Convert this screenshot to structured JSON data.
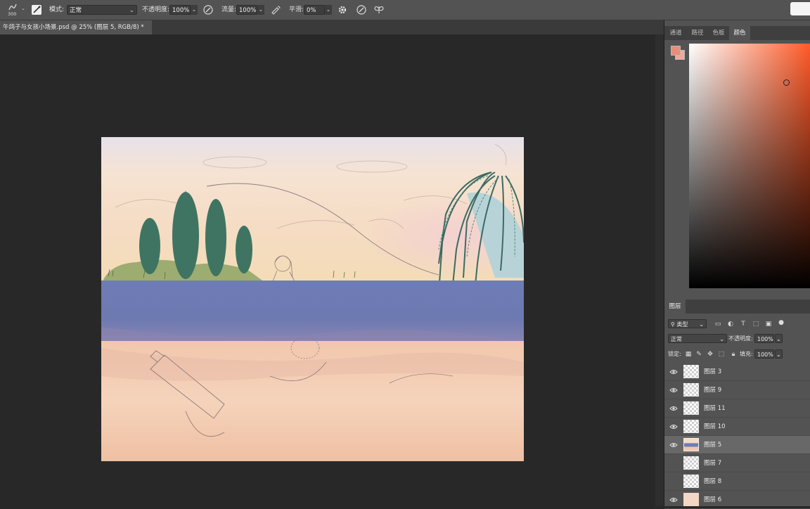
{
  "options_bar": {
    "brush_size": "300",
    "mode_label": "模式:",
    "mode_value": "正常",
    "opacity_label": "不透明度:",
    "opacity_value": "100%",
    "flow_label": "流量:",
    "flow_value": "100%",
    "smoothing_label": "平滑:",
    "smoothing_value": "0%"
  },
  "document_tab": {
    "title": "午鸽子与女孩小场景.psd @ 25% (图层 5, RGB/8) *"
  },
  "color_panel": {
    "tabs": [
      "通道",
      "路径",
      "色板",
      "颜色"
    ],
    "active_tab": "颜色",
    "foreground_color": "#e98d79",
    "background_color": "#f4a799",
    "hue_color": "#ff5a28"
  },
  "layers_panel": {
    "title": "图层",
    "filter_label": "类型",
    "blend_mode": "正常",
    "opacity_label": "不透明度:",
    "opacity_value": "100%",
    "lock_label": "锁定:",
    "fill_label": "填充:",
    "fill_value": "100%",
    "layers": [
      {
        "name": "图层 3",
        "visible": true,
        "selected": false
      },
      {
        "name": "图层 9",
        "visible": true,
        "selected": false
      },
      {
        "name": "图层 11",
        "visible": true,
        "selected": false
      },
      {
        "name": "图层 10",
        "visible": true,
        "selected": false
      },
      {
        "name": "图层 5",
        "visible": true,
        "selected": true
      },
      {
        "name": "图层 7",
        "visible": false,
        "selected": false
      },
      {
        "name": "图层 8",
        "visible": false,
        "selected": false
      },
      {
        "name": "图层 6",
        "visible": true,
        "selected": false
      }
    ]
  }
}
